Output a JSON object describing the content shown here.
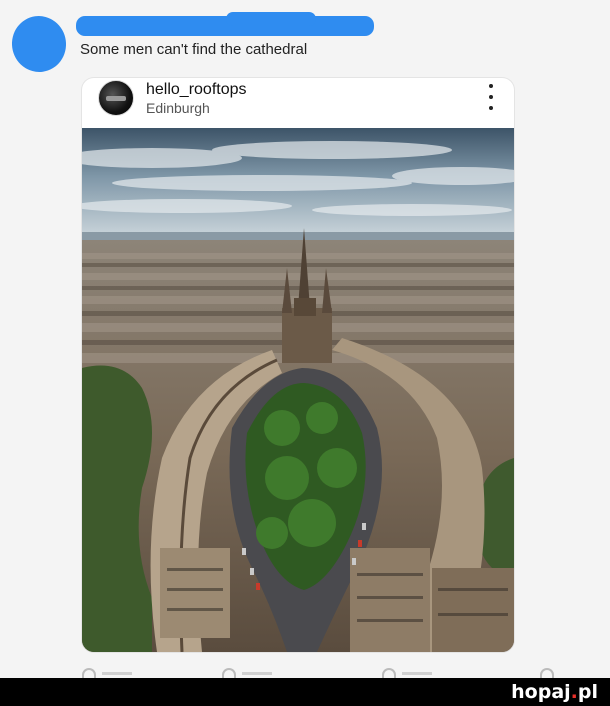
{
  "tweet": {
    "text": "Some men can't find the cathedral",
    "colors": {
      "redaction": "#2f8cf0"
    }
  },
  "instagram_card": {
    "username": "hello_rooftops",
    "location": "Edinburgh",
    "menu_icon": "more-vertical-icon"
  },
  "footer": {
    "actions": [
      "reply-icon",
      "retweet-icon",
      "like-icon",
      "share-icon"
    ]
  },
  "watermark": {
    "text_main": "hopaj",
    "text_dot": ".",
    "text_tld": "pl",
    "dot_color": "#e8302a"
  }
}
